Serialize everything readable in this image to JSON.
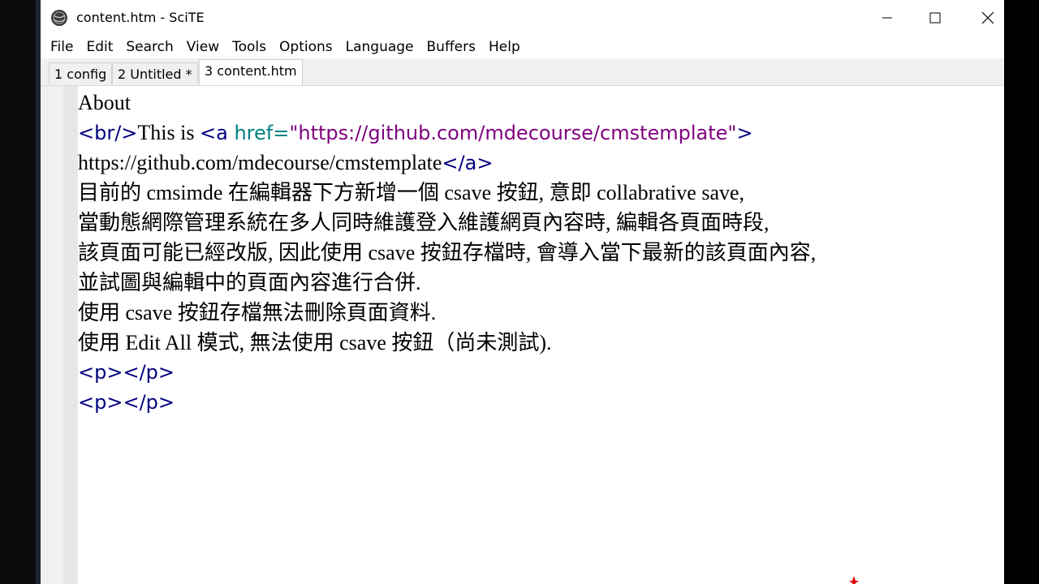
{
  "window": {
    "title": "content.htm - SciTE"
  },
  "menu": {
    "items": [
      "File",
      "Edit",
      "Search",
      "View",
      "Tools",
      "Options",
      "Language",
      "Buffers",
      "Help"
    ]
  },
  "tabs": [
    {
      "label": "1 config",
      "active": false
    },
    {
      "label": "2 Untitled *",
      "active": false
    },
    {
      "label": "3 content.htm",
      "active": true
    }
  ],
  "editor": {
    "line1": "About",
    "line2_tag_open": "<br/>",
    "line2_text": "This is ",
    "line2_a_open": "<a ",
    "line2_attr": "href=",
    "line2_value": "\"https://github.com/mdecourse/cmstemplate\"",
    "line2_close": ">",
    "line3_text": "https://github.com/mdecourse/cmstemplate",
    "line3_tag": "</a>",
    "line4": "目前的 cmsimde 在編輯器下方新增一個 csave 按鈕, 意即 collabrative save,",
    "line5": "當動態網際管理系統在多人同時維護登入維護網頁內容時, 編輯各頁面時段,",
    "line6": "該頁面可能已經改版, 因此使用 csave 按鈕存檔時, 會導入當下最新的該頁面內容,",
    "line7": "並試圖與編輯中的頁面內容進行合併.",
    "line8": "使用 csave 按鈕存檔無法刪除頁面資料.",
    "line9": "使用 Edit All 模式, 無法使用 csave 按鈕（尚未測試).",
    "line10": "<p></p>",
    "line11": "<p></p>"
  },
  "colors": {
    "tag": "#000080",
    "attribute": "#008080",
    "string": "#7f007f",
    "text": "#000000"
  }
}
